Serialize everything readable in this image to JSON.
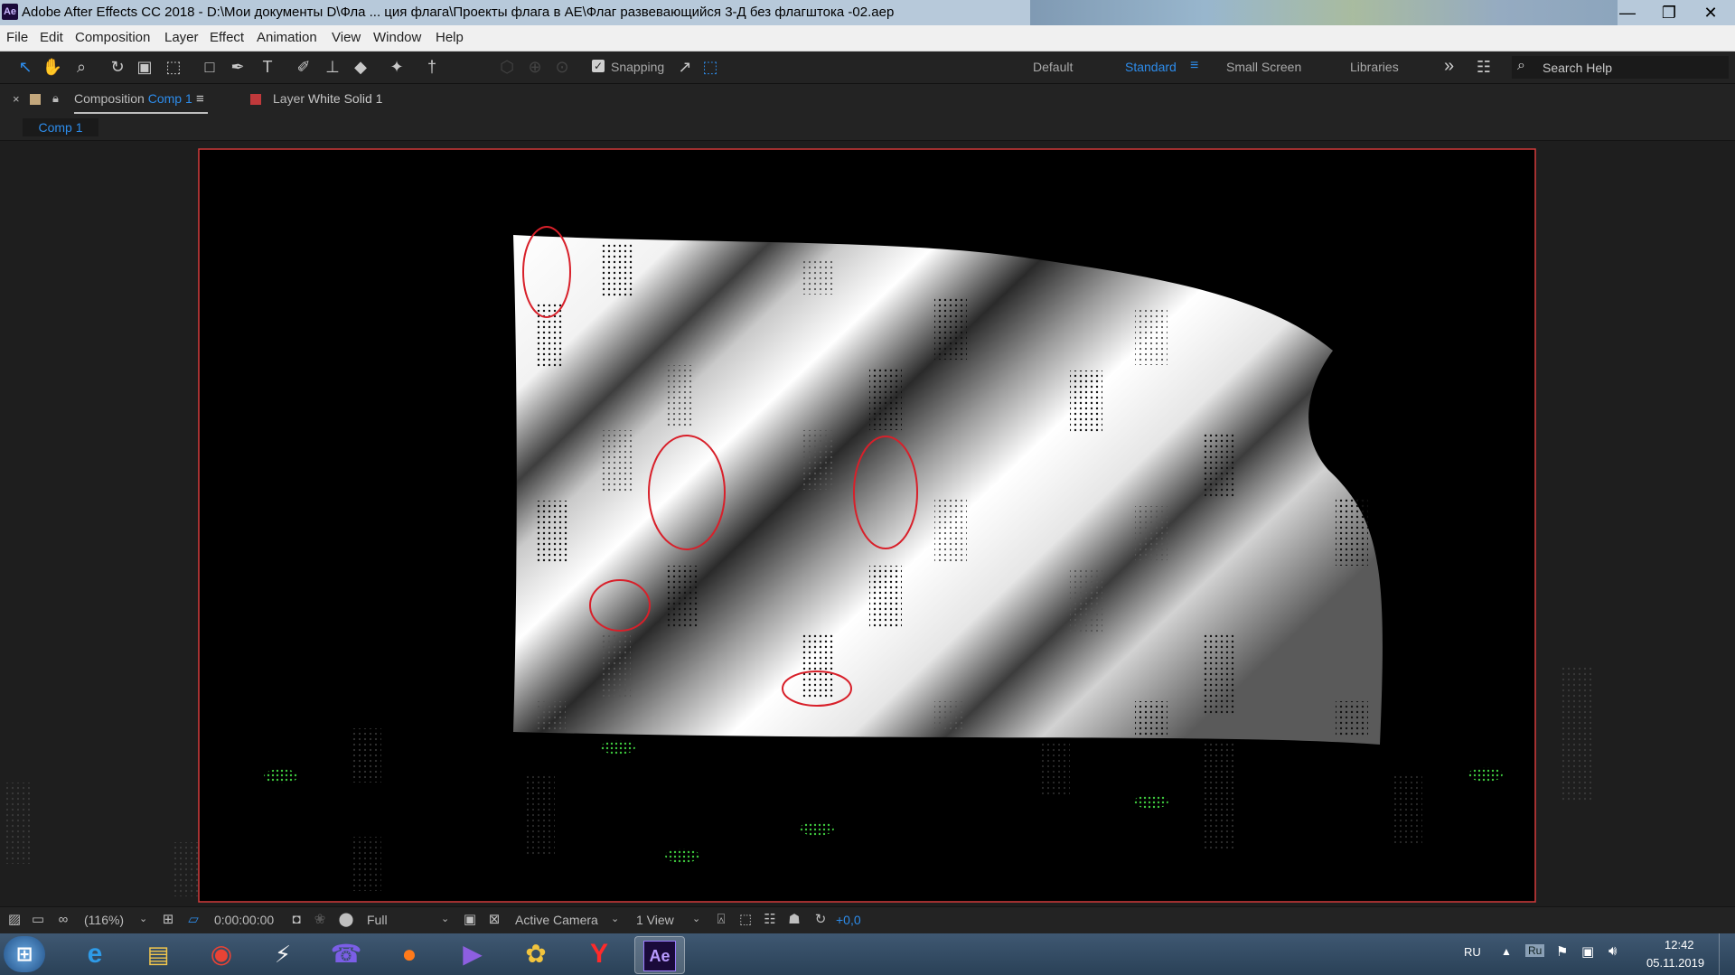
{
  "window": {
    "app_badge": "Ae",
    "title": "Adobe After Effects CC 2018 - D:\\Мои документы D\\Фла ... ция флага\\Проекты флага в AE\\Флаг развевающийся 3-Д без флагштока -02.aep",
    "minimize_glyph": "—",
    "restore_glyph": "❐",
    "close_glyph": "✕"
  },
  "menu": [
    "File",
    "Edit",
    "Composition",
    "Layer",
    "Effect",
    "Animation",
    "View",
    "Window",
    "Help"
  ],
  "toolbar": {
    "snapping_check": "✓",
    "snapping_label": "Snapping",
    "workspaces": [
      "Default",
      "Standard",
      "Small Screen",
      "Libraries"
    ],
    "menu_glyph": "≡",
    "more_glyph": "»",
    "search_placeholder": "Search Help"
  },
  "panels": {
    "close_glyph": "×",
    "comp_tab_prefix": "Composition",
    "comp_tab_name": "Comp 1",
    "comp_tab_menu": "≡",
    "layer_tab_prefix": "Layer",
    "layer_tab_name": "White Solid 1",
    "comp_chip": "Comp 1",
    "label_colors": {
      "comp": "#c3a77c",
      "layer": "#c0393b"
    }
  },
  "viewer_bar": {
    "zoom": "(116%)",
    "timecode": "0:00:00:00",
    "resolution": "Full",
    "camera": "Active Camera",
    "views": "1 View",
    "exposure": "+0,0"
  },
  "taskbar": {
    "ae_label": "Ae",
    "lang": "RU",
    "lang_badge": "Ru",
    "time": "12:42",
    "date": "05.11.2019"
  },
  "colors": {
    "accent": "#2d8ceb",
    "frame_border": "#d23b3b",
    "annotation": "#d8202a",
    "artifact_green": "#3ec83e"
  }
}
